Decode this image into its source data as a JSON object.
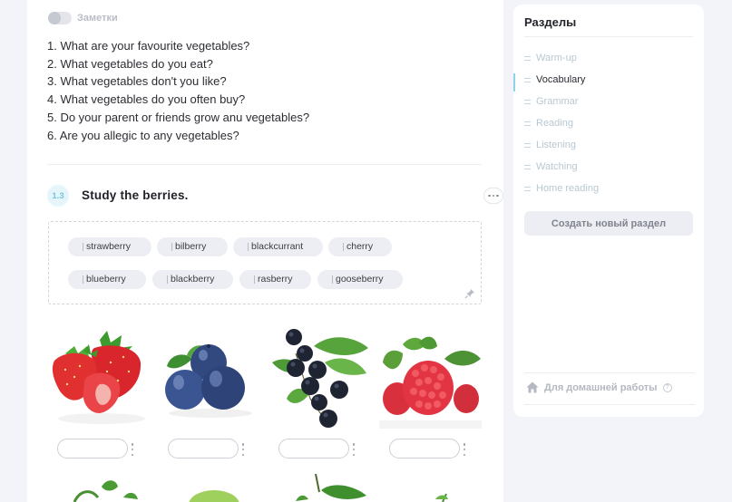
{
  "notes": {
    "label": "Заметки",
    "toggle_on": false
  },
  "questions": [
    "1. What are your favourite vegetables?",
    "2. What vegetables do you eat?",
    "3. What vegetables don't you like?",
    "4. What vegetables do you often buy?",
    "5. Do your parent or friends grow anu vegetables?",
    "6. Are you allegic to any vegetables?"
  ],
  "exercise": {
    "number": "1.3",
    "title": "Study the berries.",
    "words": [
      "strawberry",
      "bilberry",
      "blackcurrant",
      "cherry",
      "blueberry",
      "blackberry",
      "rasberry",
      "gooseberry"
    ]
  },
  "images": [
    {
      "icon": "strawberries-photo"
    },
    {
      "icon": "blueberries-photo"
    },
    {
      "icon": "blackcurrant-photo"
    },
    {
      "icon": "raspberry-photo"
    }
  ],
  "sections": {
    "title": "Разделы",
    "items": [
      {
        "label": "Warm-up",
        "active": false
      },
      {
        "label": "Vocabulary",
        "active": true
      },
      {
        "label": "Grammar",
        "active": false
      },
      {
        "label": "Reading",
        "active": false
      },
      {
        "label": "Listening",
        "active": false
      },
      {
        "label": "Watching",
        "active": false
      },
      {
        "label": "Home reading",
        "active": false
      }
    ],
    "create_button": "Создать новый раздел",
    "homework_label": "Для домашней работы",
    "help_glyph": "?"
  },
  "colors": {
    "accent": "#8fd3e7",
    "background": "#f3f4f9",
    "chip": "#eceef3"
  }
}
